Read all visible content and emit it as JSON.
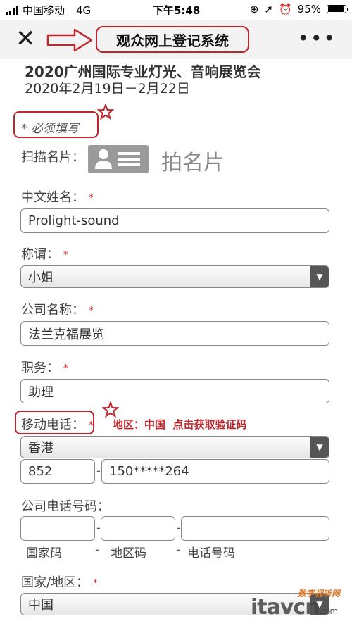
{
  "status_bar": {
    "carrier": "中国移动",
    "network": "4G",
    "time": "下午5:48",
    "battery": "95%"
  },
  "nav": {
    "close_icon": "close-icon",
    "title": "观众网上登记系统",
    "more_icon": "more-icon"
  },
  "form": {
    "event_title": "2020广州国际专业灯光、音响展览会",
    "event_dates": "2020年2月19日－2月22日",
    "required_note": "* 必须填写",
    "scan_card_label": "扫描名片：",
    "scan_card_button": "拍名片",
    "chinese_name_label": "中文姓名：",
    "chinese_name_value": "Prolight-sound",
    "title_label": "称谓：",
    "title_value": "小姐",
    "company_label": "公司名称：",
    "company_value": "法兰克福展览",
    "position_label": "职务：",
    "position_value": "助理",
    "mobile_label": "移动电话：",
    "mobile_hint": "地区：中国  点击获取验证码",
    "mobile_region": "香港",
    "mobile_country_code": "852",
    "mobile_number": "150*****264",
    "company_phone_label": "公司电话号码：",
    "company_phone_country_code_label": "国家码",
    "company_phone_area_code_label": "地区码",
    "company_phone_number_label": "电话号码",
    "country_label": "国家/地区：",
    "country_value": "中国",
    "required_marker": "*"
  },
  "watermark": {
    "logo_text": "itavcn",
    "logo_suffix": ".com",
    "site_name": "数字视听网"
  },
  "colors": {
    "annotation_red": "#c0262b",
    "required_red": "#dd2222"
  }
}
